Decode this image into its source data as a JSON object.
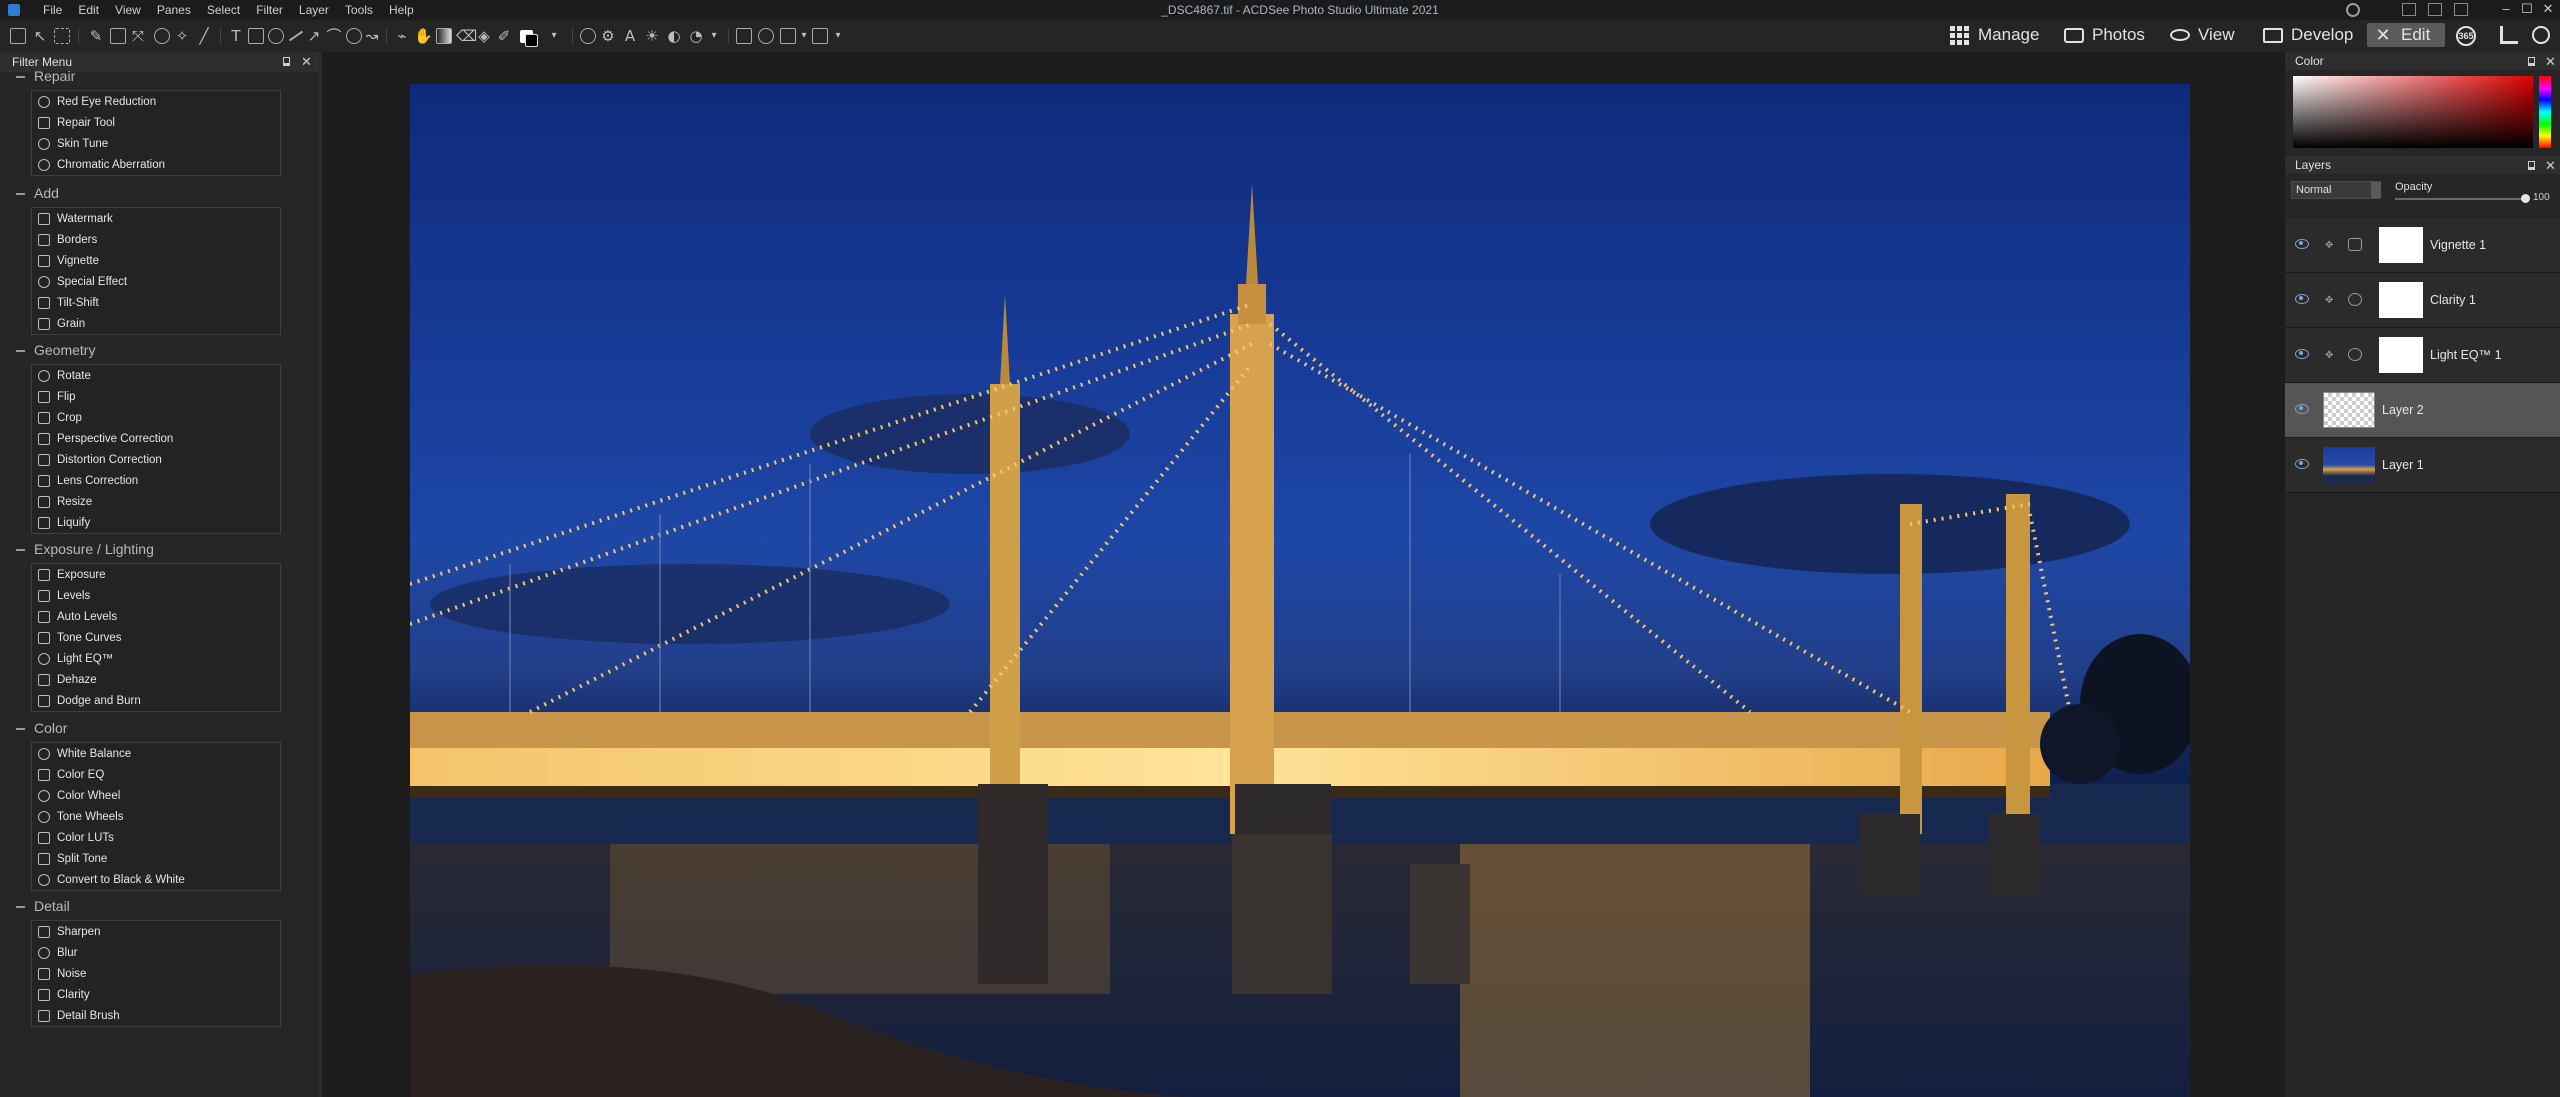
{
  "app": {
    "window_title": "_DSC4867.tif - ACDSee Photo Studio Ultimate 2021",
    "menu": [
      "File",
      "Edit",
      "View",
      "Panes",
      "Select",
      "Filter",
      "Layer",
      "Tools",
      "Help"
    ],
    "window_controls": {
      "minimize": "–",
      "maximize": "☐",
      "close": "✕"
    }
  },
  "modes": [
    {
      "label": "Manage",
      "icon": "grid-icon",
      "active": false
    },
    {
      "label": "Photos",
      "icon": "photos-icon",
      "active": false
    },
    {
      "label": "View",
      "icon": "eye-icon",
      "active": false
    },
    {
      "label": "Develop",
      "icon": "develop-icon",
      "active": false
    },
    {
      "label": "Edit",
      "icon": "edit-icon",
      "active": true
    }
  ],
  "mode_extra": {
    "badge": "365"
  },
  "filter_menu": {
    "title": "Filter Menu",
    "groups": [
      {
        "title": "Repair",
        "items": [
          "Red Eye Reduction",
          "Repair Tool",
          "Skin Tune",
          "Chromatic Aberration"
        ]
      },
      {
        "title": "Add",
        "items": [
          "Watermark",
          "Borders",
          "Vignette",
          "Special Effect",
          "Tilt-Shift",
          "Grain"
        ]
      },
      {
        "title": "Geometry",
        "items": [
          "Rotate",
          "Flip",
          "Crop",
          "Perspective Correction",
          "Distortion Correction",
          "Lens Correction",
          "Resize",
          "Liquify"
        ]
      },
      {
        "title": "Exposure / Lighting",
        "items": [
          "Exposure",
          "Levels",
          "Auto Levels",
          "Tone Curves",
          "Light EQ™",
          "Dehaze",
          "Dodge and Burn"
        ]
      },
      {
        "title": "Color",
        "items": [
          "White Balance",
          "Color EQ",
          "Color Wheel",
          "Tone Wheels",
          "Color LUTs",
          "Split Tone",
          "Convert to Black & White"
        ]
      },
      {
        "title": "Detail",
        "items": [
          "Sharpen",
          "Blur",
          "Noise",
          "Clarity",
          "Detail Brush"
        ]
      }
    ]
  },
  "color_panel": {
    "title": "Color",
    "colors": {
      "hue": "#e00000"
    }
  },
  "layers_panel": {
    "title": "Layers",
    "blend_mode": "Normal",
    "opacity_label": "Opacity",
    "opacity_value": "100",
    "layers": [
      {
        "name": "Vignette 1",
        "type": "adjustment",
        "icon": "vignette-icon",
        "thumb": "white",
        "selected": false
      },
      {
        "name": "Clarity 1",
        "type": "adjustment",
        "icon": "clarity-icon",
        "thumb": "white",
        "selected": false
      },
      {
        "name": "Light EQ™ 1",
        "type": "adjustment",
        "icon": "light-eq-icon",
        "thumb": "white",
        "selected": false
      },
      {
        "name": "Layer 2",
        "type": "pixel",
        "icon": "",
        "thumb": "transparent",
        "selected": true
      },
      {
        "name": "Layer 1",
        "type": "pixel",
        "icon": "",
        "thumb": "photo",
        "selected": false
      }
    ]
  }
}
